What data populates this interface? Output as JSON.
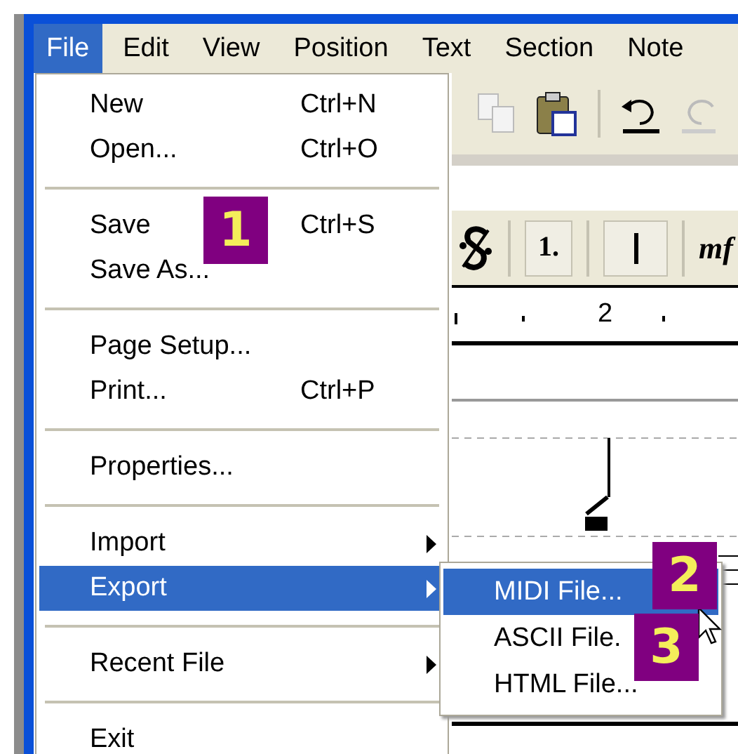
{
  "menubar": [
    {
      "label": "File",
      "selected": true
    },
    {
      "label": "Edit",
      "selected": false
    },
    {
      "label": "View",
      "selected": false
    },
    {
      "label": "Position",
      "selected": false
    },
    {
      "label": "Text",
      "selected": false
    },
    {
      "label": "Section",
      "selected": false
    },
    {
      "label": "Note",
      "selected": false
    }
  ],
  "file_menu": [
    {
      "kind": "item",
      "label": "New",
      "shortcut": "Ctrl+N",
      "selected": false
    },
    {
      "kind": "item",
      "label": "Open...",
      "shortcut": "Ctrl+O",
      "selected": false
    },
    {
      "kind": "separator"
    },
    {
      "kind": "item",
      "label": "Save",
      "shortcut": "Ctrl+S",
      "selected": false
    },
    {
      "kind": "item",
      "label": "Save As...",
      "selected": false
    },
    {
      "kind": "separator"
    },
    {
      "kind": "item",
      "label": "Page Setup...",
      "selected": false
    },
    {
      "kind": "item",
      "label": "Print...",
      "shortcut": "Ctrl+P",
      "selected": false
    },
    {
      "kind": "separator"
    },
    {
      "kind": "item",
      "label": "Properties...",
      "selected": false
    },
    {
      "kind": "separator"
    },
    {
      "kind": "submenu",
      "label": "Import",
      "selected": false
    },
    {
      "kind": "submenu",
      "label": "Export",
      "selected": true
    },
    {
      "kind": "separator"
    },
    {
      "kind": "submenu",
      "label": "Recent File",
      "selected": false
    },
    {
      "kind": "separator"
    },
    {
      "kind": "item",
      "label": "Exit",
      "selected": false
    }
  ],
  "export_submenu": [
    {
      "label": "MIDI File...",
      "selected": true
    },
    {
      "label": "ASCII File.",
      "selected": false
    },
    {
      "label": "HTML File...",
      "selected": false
    }
  ],
  "callouts": [
    "1",
    "2",
    "3"
  ],
  "toolbar": {
    "ending_label": "1.",
    "dynamic_label": "mf"
  },
  "ruler": {
    "measure": "2"
  }
}
